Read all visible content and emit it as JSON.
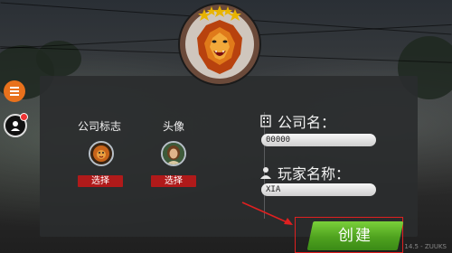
{
  "colors": {
    "accent_orange": "#e8711c",
    "select_red": "#b01a1a",
    "create_green": "#5cb82a",
    "annotation_red": "#e02020",
    "panel_bg": "#2a2c2e"
  },
  "icons": {
    "menu": "hamburger-menu-icon",
    "profile": "user-profile-icon",
    "company": "building-icon",
    "player": "person-icon",
    "logo": "lion-logo"
  },
  "left": {
    "company_logo_label": "公司标志",
    "avatar_label": "头像",
    "select_label_logo": "选择",
    "select_label_avatar": "选择"
  },
  "form": {
    "company_name_label": "公司名：",
    "company_name_value": "00000",
    "player_name_label": "玩家名称：",
    "player_name_value": "XIA"
  },
  "create_button": {
    "label": "创建"
  },
  "version": "14.5 - ZUUKS"
}
